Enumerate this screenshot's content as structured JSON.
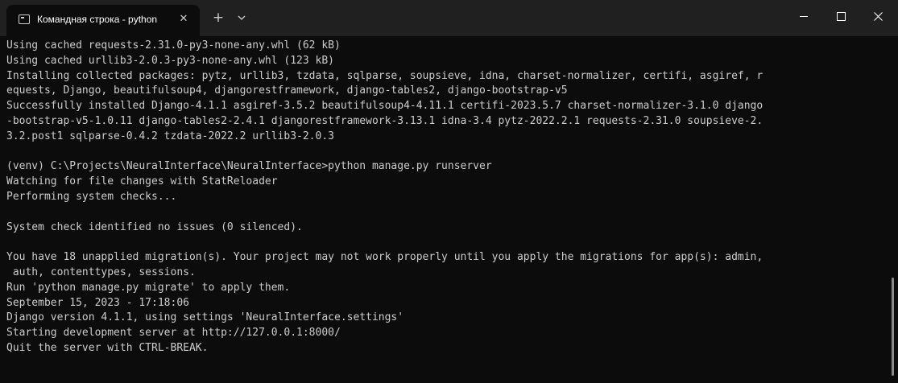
{
  "titlebar": {
    "tab_title": "Командная строка - python",
    "tab_icon": "terminal-icon",
    "close_tab_glyph": "✕",
    "new_tab_glyph": "+"
  },
  "terminal": {
    "lines": [
      "Using cached requests-2.31.0-py3-none-any.whl (62 kB)",
      "Using cached urllib3-2.0.3-py3-none-any.whl (123 kB)",
      "Installing collected packages: pytz, urllib3, tzdata, sqlparse, soupsieve, idna, charset-normalizer, certifi, asgiref, r",
      "equests, Django, beautifulsoup4, djangorestframework, django-tables2, django-bootstrap-v5",
      "Successfully installed Django-4.1.1 asgiref-3.5.2 beautifulsoup4-4.11.1 certifi-2023.5.7 charset-normalizer-3.1.0 django",
      "-bootstrap-v5-1.0.11 django-tables2-2.4.1 djangorestframework-3.13.1 idna-3.4 pytz-2022.2.1 requests-2.31.0 soupsieve-2.",
      "3.2.post1 sqlparse-0.4.2 tzdata-2022.2 urllib3-2.0.3",
      "",
      "(venv) C:\\Projects\\NeuralInterface\\NeuralInterface>python manage.py runserver",
      "Watching for file changes with StatReloader",
      "Performing system checks...",
      "",
      "System check identified no issues (0 silenced).",
      "",
      "You have 18 unapplied migration(s). Your project may not work properly until you apply the migrations for app(s): admin,",
      " auth, contenttypes, sessions.",
      "Run 'python manage.py migrate' to apply them.",
      "September 15, 2023 - 17:18:06",
      "Django version 4.1.1, using settings 'NeuralInterface.settings'",
      "Starting development server at http://127.0.0.1:8000/",
      "Quit the server with CTRL-BREAK."
    ]
  },
  "colors": {
    "background": "#0c0c0c",
    "titlebar": "#202020",
    "text": "#cccccc"
  }
}
